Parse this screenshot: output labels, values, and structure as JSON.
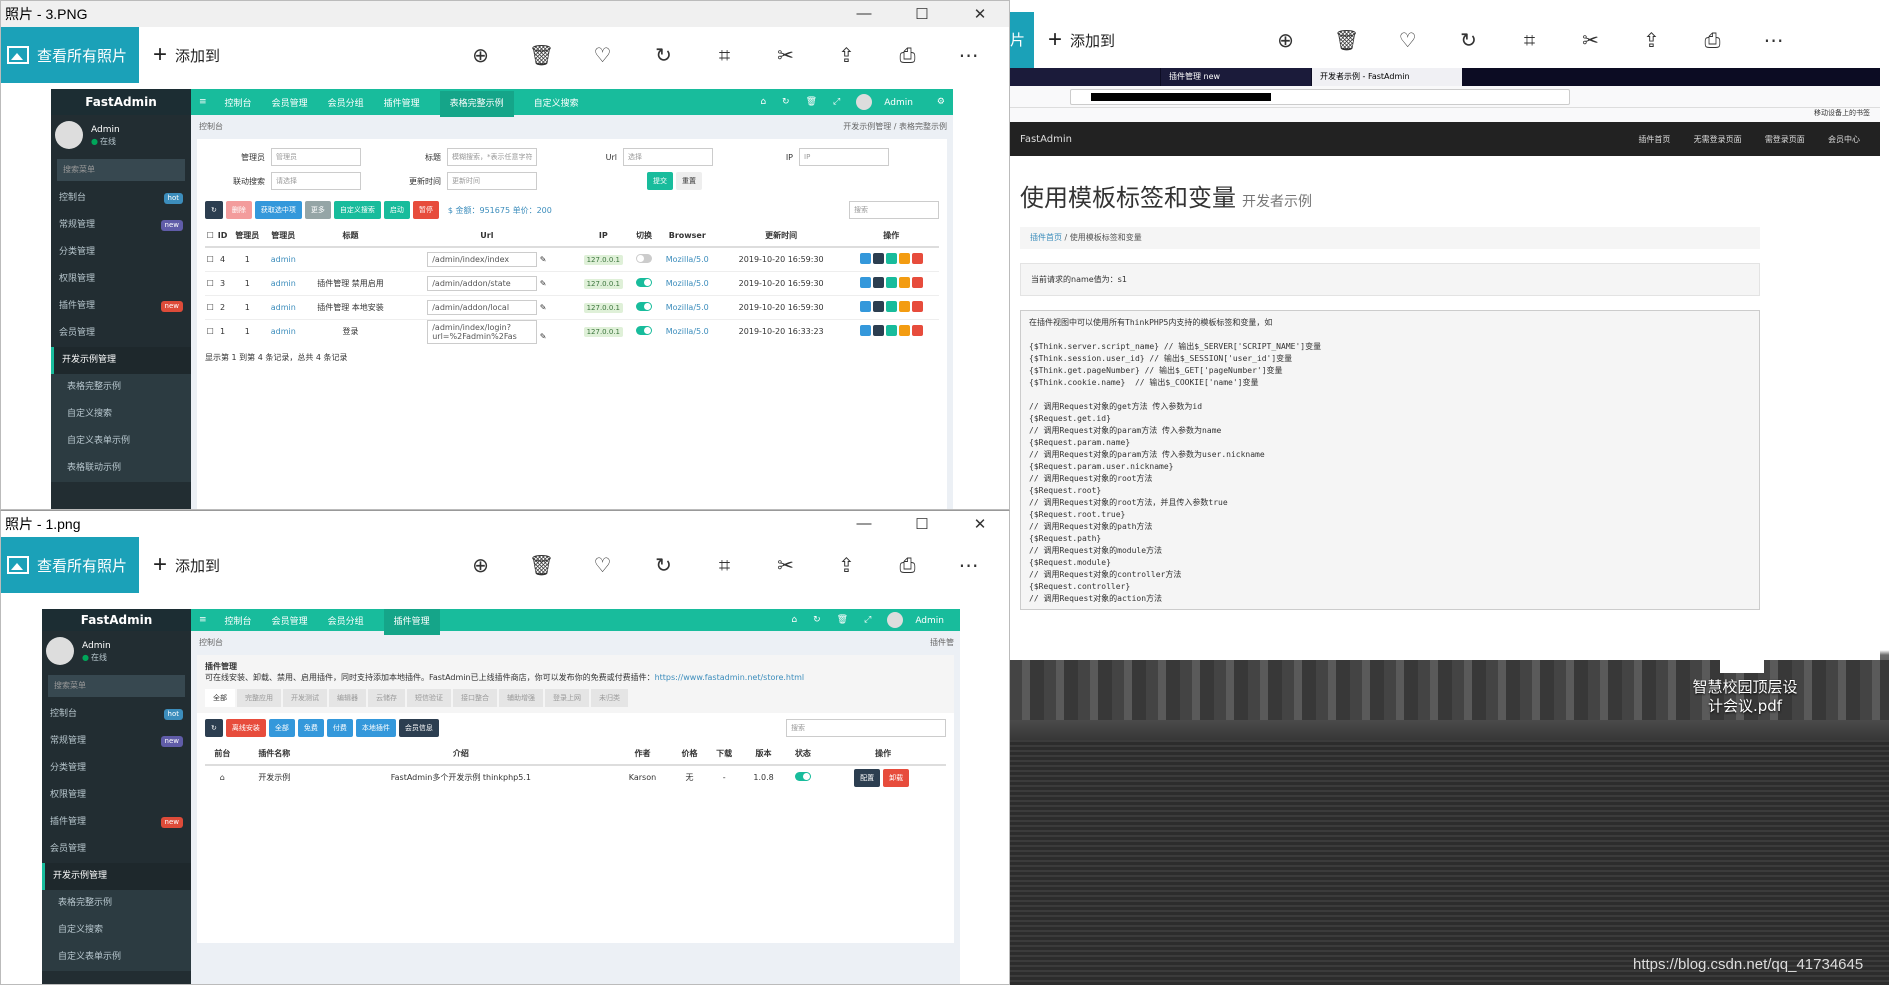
{
  "window1": {
    "title": "照片 - 3.PNG",
    "view_all": "查看所有照片",
    "add_to": "添加到"
  },
  "window2": {
    "title": "照片 - 1.png",
    "view_all": "查看所有照片",
    "add_to": "添加到"
  },
  "window3": {
    "view_all_edge": "片",
    "add_to": "添加到"
  },
  "toolbar_icons": [
    "zoom-icon",
    "delete-icon",
    "heart-icon",
    "rotate-icon",
    "crop-icon",
    "edit-icon",
    "share-icon",
    "print-icon",
    "more-icon"
  ],
  "fa1": {
    "logo": "FastAdmin",
    "user": "Admin",
    "status": "在线",
    "search": "搜索菜单",
    "menu": [
      {
        "label": "控制台",
        "badge": "hot"
      },
      {
        "label": "常规管理",
        "badge": "new"
      },
      {
        "label": "分类管理"
      },
      {
        "label": "权限管理"
      },
      {
        "label": "插件管理",
        "badge": "new"
      },
      {
        "label": "会员管理"
      },
      {
        "label": "开发示例管理"
      },
      {
        "label": "表格完整示例",
        "sub": true
      },
      {
        "label": "自定义搜索",
        "sub": true
      },
      {
        "label": "自定义表单示例",
        "sub": true
      },
      {
        "label": "表格联动示例",
        "sub": true
      }
    ],
    "topnav": [
      "控制台",
      "会员管理",
      "会员分组",
      "插件管理",
      "表格完整示例",
      "自定义搜索"
    ],
    "topnav_active": 4,
    "admin": "Admin",
    "crumb_left": "控制台",
    "crumb_right": "开发示例管理 / 表格完整示例",
    "form": [
      {
        "label": "管理员",
        "value": "管理员"
      },
      {
        "label": "标题",
        "value": "模糊搜索，*表示任意字符"
      },
      {
        "label": "Url",
        "value": "选择"
      },
      {
        "label": "IP",
        "value": "IP"
      },
      {
        "label": "联动搜索",
        "value": "请选择"
      },
      {
        "label": "更新时间",
        "value": "更新时间"
      }
    ],
    "submit": "提交",
    "reset": "重置",
    "buttons": [
      "删除",
      "获取选中项",
      "更多",
      "自定义搜索",
      "启动",
      "暂停"
    ],
    "stats": "$ 金额：951675 单价：200",
    "search_ph": "搜索",
    "columns": [
      "ID",
      "管理员",
      "管理员",
      "标题",
      "Url",
      "IP",
      "切换",
      "Browser",
      "更新时间",
      "操作"
    ],
    "rows": [
      {
        "id": "4",
        "admin_id": "1",
        "admin": "admin",
        "title": "",
        "url": "/admin/index/index",
        "ip": "127.0.0.1",
        "on": false,
        "browser": "Mozilla/5.0",
        "time": "2019-10-20 16:59:30"
      },
      {
        "id": "3",
        "admin_id": "1",
        "admin": "admin",
        "title": "插件管理 禁用启用",
        "url": "/admin/addon/state",
        "ip": "127.0.0.1",
        "on": true,
        "browser": "Mozilla/5.0",
        "time": "2019-10-20 16:59:30"
      },
      {
        "id": "2",
        "admin_id": "1",
        "admin": "admin",
        "title": "插件管理 本地安装",
        "url": "/admin/addon/local",
        "ip": "127.0.0.1",
        "on": true,
        "browser": "Mozilla/5.0",
        "time": "2019-10-20 16:59:30"
      },
      {
        "id": "1",
        "admin_id": "1",
        "admin": "admin",
        "title": "登录",
        "url": "/admin/index/login?url=%2Fadmin%2Fas",
        "ip": "127.0.0.1",
        "on": true,
        "browser": "Mozilla/5.0",
        "time": "2019-10-20 16:33:23"
      }
    ],
    "footer": "显示第 1 到第 4 条记录，总共 4 条记录"
  },
  "fa2": {
    "logo": "FastAdmin",
    "user": "Admin",
    "status": "在线",
    "search": "搜索菜单",
    "menu": [
      {
        "label": "控制台",
        "badge": "hot"
      },
      {
        "label": "常规管理",
        "badge": "new"
      },
      {
        "label": "分类管理"
      },
      {
        "label": "权限管理"
      },
      {
        "label": "插件管理",
        "badge": "new"
      },
      {
        "label": "会员管理"
      },
      {
        "label": "开发示例管理"
      },
      {
        "label": "表格完整示例",
        "sub": true
      },
      {
        "label": "自定义搜索",
        "sub": true
      },
      {
        "label": "自定义表单示例",
        "sub": true
      }
    ],
    "topnav": [
      "控制台",
      "会员管理",
      "会员分组",
      "插件管理"
    ],
    "topnav_active": 3,
    "admin": "Admin",
    "crumb_left": "控制台",
    "crumb_right": "插件管",
    "panel_title": "插件管理",
    "panel_desc": "可在线安装、卸载、禁用、启用插件，同时支持添加本地插件。FastAdmin已上线插件商店，你可以发布你的免费或付费插件：",
    "panel_link": "https://www.fastadmin.net/store.html",
    "tabs": [
      "全部",
      "完整应用",
      "开发测试",
      "编辑器",
      "云储存",
      "短信验证",
      "接口整合",
      "辅助增强",
      "登录上网",
      "未归类"
    ],
    "buttons": [
      "离线安装",
      "全部",
      "免费",
      "付费",
      "本地插件",
      "会员信息"
    ],
    "search_ph": "搜索",
    "columns": [
      "前台",
      "插件名称",
      "介绍",
      "作者",
      "价格",
      "下载",
      "版本",
      "状态",
      "操作"
    ],
    "row": {
      "name": "开发示例",
      "intro": "FastAdmin多个开发示例 thinkphp5.1",
      "author": "Karson",
      "price": "无",
      "download": "-",
      "version": "1.0.8",
      "config": "配置",
      "uninstall": "卸载"
    }
  },
  "browser": {
    "tabs": [
      "",
      "插件管理 new",
      "开发者示例 - FastAdmin"
    ],
    "bookmarks": "移动设备上的书签",
    "site_logo": "FastAdmin",
    "site_nav": [
      "插件首页",
      "无需登录页面",
      "需登录页面",
      "会员中心"
    ],
    "title": "使用模板标签和变量",
    "subtitle": "开发者示例",
    "crumb_home": "插件首页",
    "crumb_cur": "使用模板标签和变量",
    "request_note": "当前请求的name值为：s1",
    "pre_intro": "在插件视图中可以使用所有ThinkPHP5内支持的模板标签和变量，如",
    "code": [
      "",
      "{$Think.server.script_name} // 输出$_SERVER['SCRIPT_NAME']变量",
      "{$Think.session.user_id} // 输出$_SESSION['user_id']变量",
      "{$Think.get.pageNumber} // 输出$_GET['pageNumber']变量",
      "{$Think.cookie.name}  // 输出$_COOKIE['name']变量",
      "",
      "// 调用Request对象的get方法 传入参数为id",
      "{$Request.get.id}",
      "// 调用Request对象的param方法 传入参数为name",
      "{$Request.param.name}",
      "// 调用Request对象的param方法 传入参数为user.nickname",
      "{$Request.param.user.nickname}",
      "// 调用Request对象的root方法",
      "{$Request.root}",
      "// 调用Request对象的root方法，并且传入参数true",
      "{$Request.root.true}",
      "// 调用Request对象的path方法",
      "{$Request.path}",
      "// 调用Request对象的module方法",
      "{$Request.module}",
      "// 调用Request对象的controller方法",
      "{$Request.controller}",
      "// 调用Request对象的action方法"
    ]
  },
  "desktop": {
    "pdf_label": "智慧校园顶层设计会议.pdf",
    "watermark": "https://blog.csdn.net/qq_41734645"
  }
}
